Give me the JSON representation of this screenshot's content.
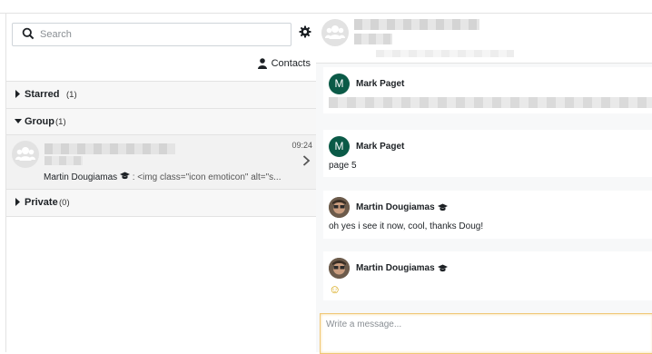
{
  "search": {
    "placeholder": "Search"
  },
  "contacts_label": "Contacts",
  "sections": {
    "starred": {
      "label": "Starred",
      "count": "(1)"
    },
    "group": {
      "label": "Group",
      "count": "(1)"
    },
    "private": {
      "label": "Private",
      "count": "(0)"
    }
  },
  "group_conversation": {
    "time": "09:24",
    "last_sender": "Martin Dougiamas",
    "last_message": ": <img class=\"icon emoticon\" alt=\"s..."
  },
  "messages": [
    {
      "sender": "Mark Paget",
      "initial": "M",
      "text": ""
    },
    {
      "sender": "Mark Paget",
      "initial": "M",
      "text": "page 5"
    },
    {
      "sender": "Martin Dougiamas",
      "text": "oh yes i see it now, cool, thanks Doug!"
    },
    {
      "sender": "Martin Dougiamas",
      "text": "☺"
    }
  ],
  "composer": {
    "placeholder": "Write a message..."
  },
  "colors": {
    "avatar_green": "#0b5a47",
    "compose_border": "#f0c775"
  }
}
